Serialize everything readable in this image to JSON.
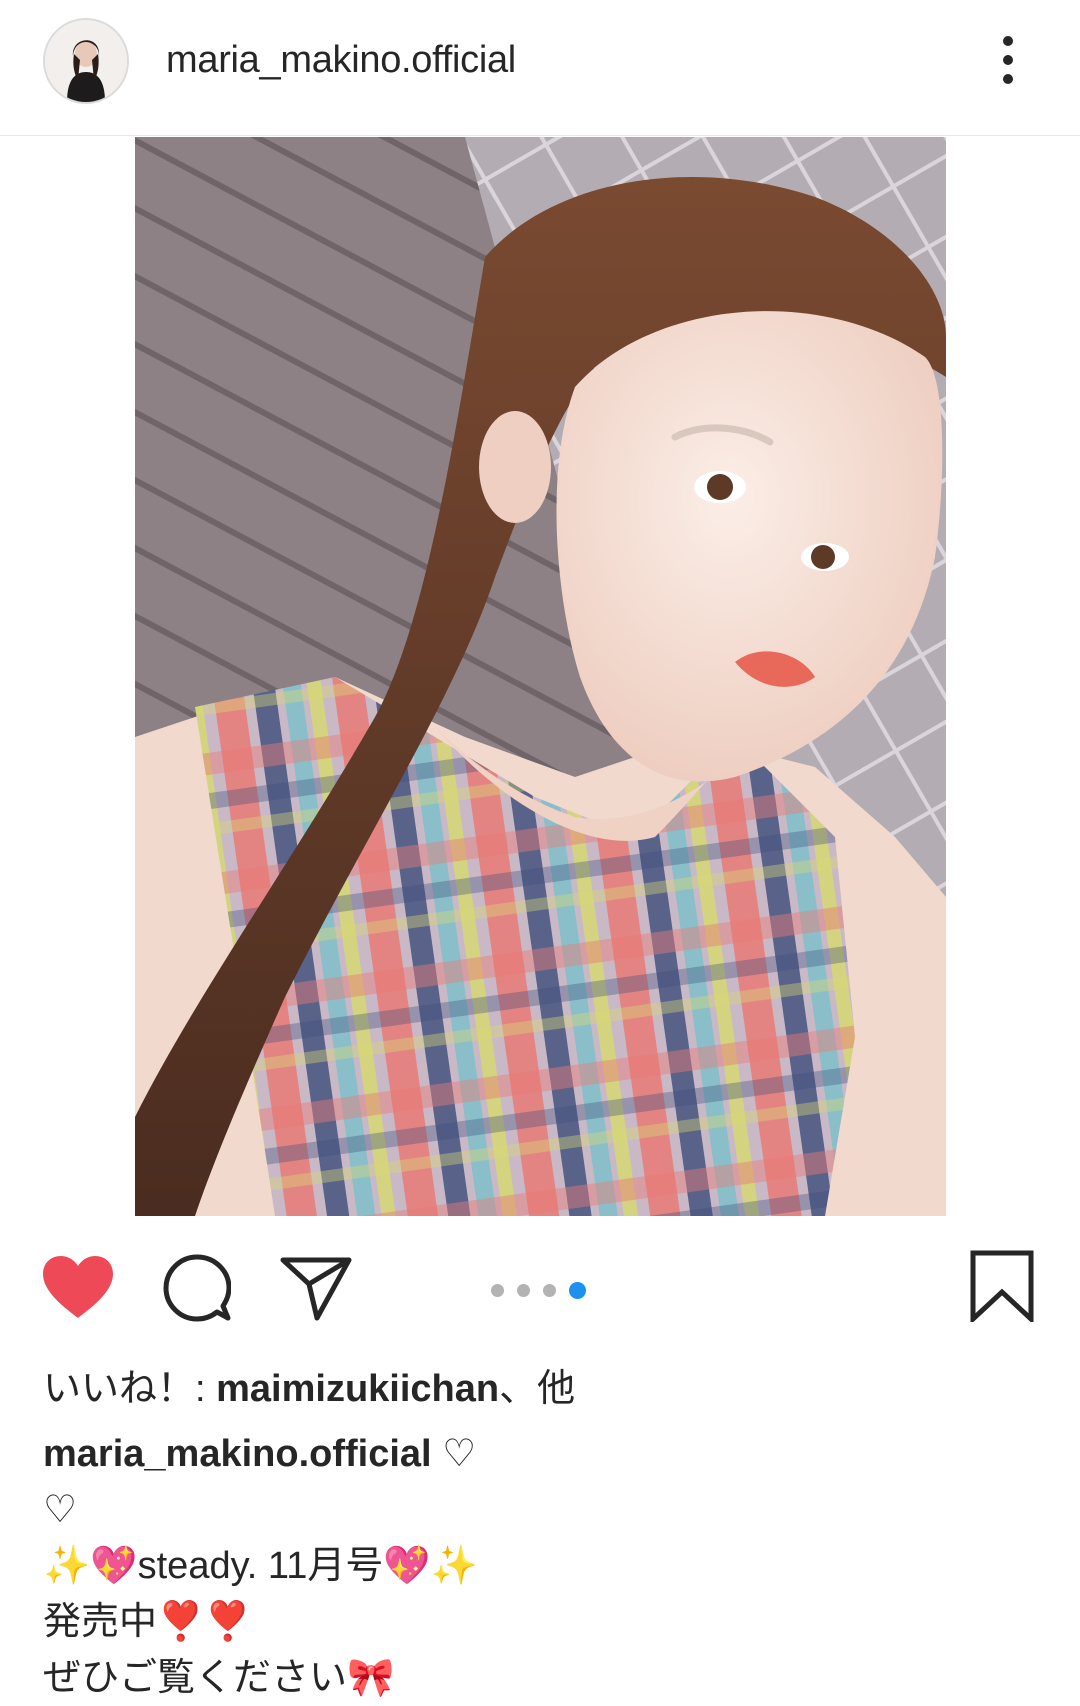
{
  "header": {
    "username": "maria_makino.official",
    "avatar_icon": "profile-photo",
    "more_icon": "more-vertical-icon"
  },
  "post": {
    "photo_description_icon": "post-photo",
    "carousel": {
      "count": 4,
      "active_index": 3
    }
  },
  "actions": {
    "like_icon": "heart-filled-icon",
    "like_color": "#ed4956",
    "comment_icon": "comment-icon",
    "share_icon": "send-icon",
    "save_icon": "bookmark-icon",
    "carousel_active_color": "#1e90f0"
  },
  "likes": {
    "prefix": "いいね！: ",
    "user": "maimizukiichan",
    "suffix": "、他"
  },
  "caption": {
    "user": "maria_makino.official",
    "line1_rest": " ♡",
    "line2": "♡",
    "line3": "✨💖steady. 11月号💖✨",
    "line4": "発売中❣️❣️",
    "line5": "ぜひご覧ください🎀"
  }
}
